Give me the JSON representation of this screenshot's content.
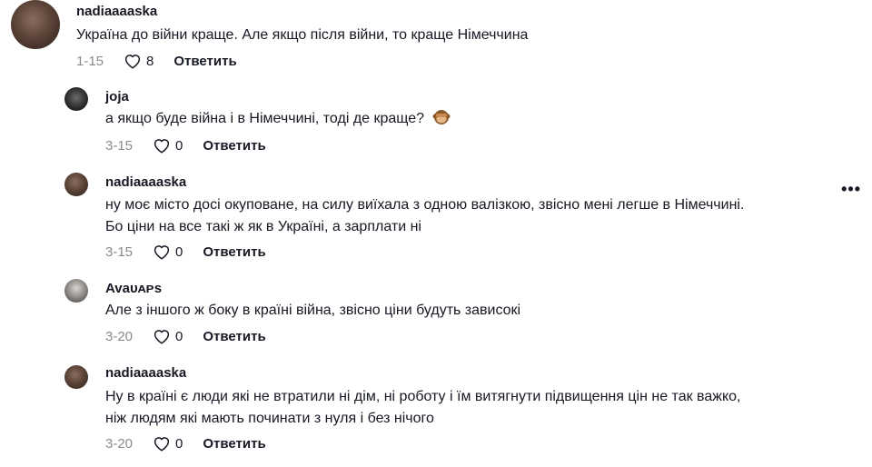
{
  "comments": [
    {
      "username": "nadiaaaaska",
      "text": [
        "Україна до війни краще. Але якщо після війни, то краще Німеччина"
      ],
      "date": "1-15",
      "likes": "8",
      "reply_label": "Ответить",
      "avatar_icon": "user-avatar"
    },
    {
      "username": "joja",
      "text": [
        "а якщо буде війна і в Німеччині, тоді де краще? "
      ],
      "emoji": "see-no-evil-monkey-icon",
      "date": "3-15",
      "likes": "0",
      "reply_label": "Ответить",
      "avatar_icon": "user-avatar"
    },
    {
      "username": "nadiaaaaska",
      "text": [
        "ну моє місто досі окуповане, на силу виїхала з одною валізкою, звісно мені легше в Німеччині.",
        "Бо ціни на все такі ж як в Україні, а зарплати ні"
      ],
      "date": "3-15",
      "likes": "0",
      "reply_label": "Ответить",
      "avatar_icon": "user-avatar"
    },
    {
      "username": "Avaᴜᴀᴘs",
      "text": [
        "Але з іншого ж боку в країні війна, звісно ціни будуть зависокі"
      ],
      "date": "3-20",
      "likes": "0",
      "reply_label": "Ответить",
      "avatar_icon": "user-avatar"
    },
    {
      "username": "nadiaaaaska",
      "text": [
        "Ну в країні є люди які не втратили ні дім, ні роботу і їм витягнути підвищення цін не так важко,",
        "ніж людям які мають починати з нуля і без нічого"
      ],
      "date": "3-20",
      "likes": "0",
      "reply_label": "Ответить",
      "avatar_icon": "user-avatar"
    }
  ],
  "more_button": "•••",
  "colors": {
    "text": "#161823",
    "muted": "#8a8b91",
    "background": "#ffffff"
  }
}
